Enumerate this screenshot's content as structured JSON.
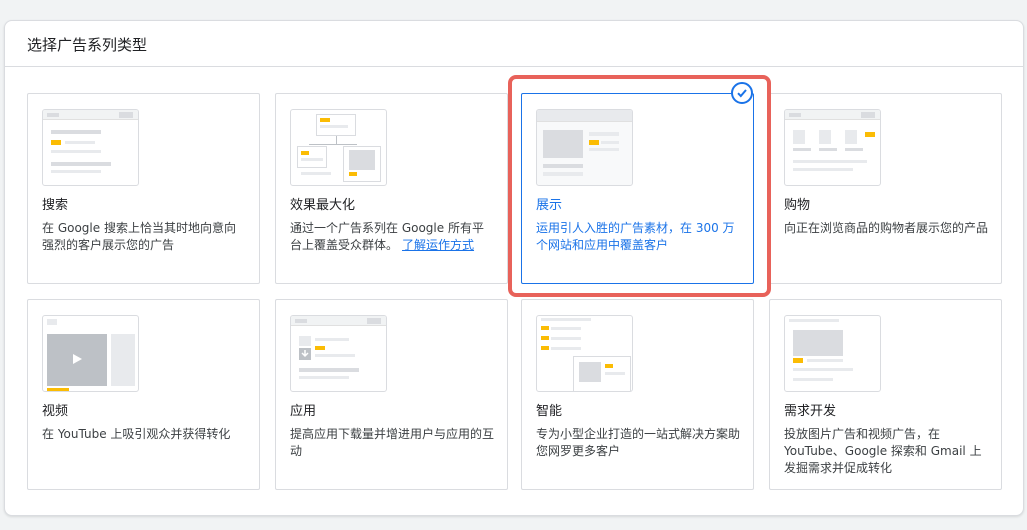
{
  "panel": {
    "title": "选择广告系列类型"
  },
  "cards": [
    {
      "title": "搜索",
      "desc": "在 Google 搜索上恰当其时地向意向强烈的客户展示您的广告"
    },
    {
      "title": "效果最大化",
      "desc": "通过一个广告系列在 Google 所有平台上覆盖受众群体。",
      "link": "了解运作方式"
    },
    {
      "title": "展示",
      "desc": "运用引人入胜的广告素材，在 300 万个网站和应用中覆盖客户"
    },
    {
      "title": "购物",
      "desc": "向正在浏览商品的购物者展示您的产品"
    },
    {
      "title": "视频",
      "desc": "在 YouTube 上吸引观众并获得转化"
    },
    {
      "title": "应用",
      "desc": "提高应用下载量并增进用户与应用的互动"
    },
    {
      "title": "智能",
      "desc": "专为小型企业打造的一站式解决方案助您网罗更多客户"
    },
    {
      "title": "需求开发",
      "desc": "投放图片广告和视频广告，在 YouTube、Google 探索和 Gmail 上发掘需求并促成转化"
    }
  ],
  "selected_index": 2,
  "colors": {
    "accent": "#1a73e8",
    "highlight": "#e8625a",
    "thumb_yellow": "#fbbc04"
  }
}
